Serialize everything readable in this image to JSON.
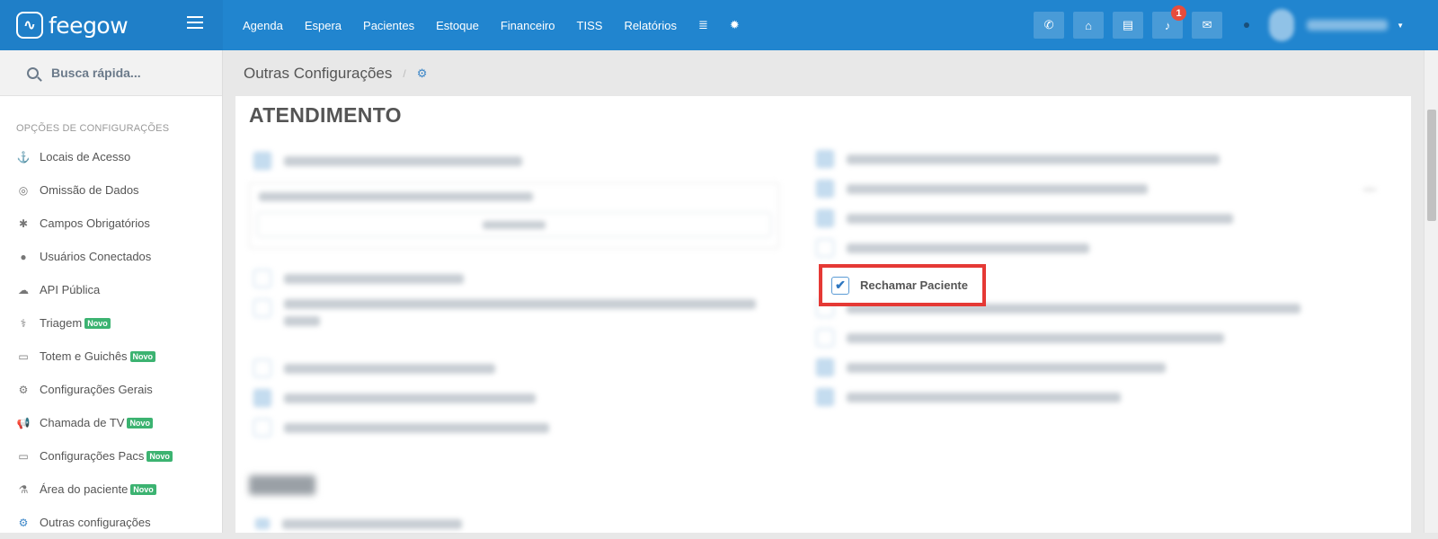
{
  "brand": {
    "logo_icon": "heartbeat-icon",
    "name": "feegow"
  },
  "nav": {
    "items": [
      "Agenda",
      "Espera",
      "Pacientes",
      "Estoque",
      "Financeiro",
      "TISS",
      "Relatórios"
    ],
    "icons": [
      "database-icon",
      "gear-icon"
    ]
  },
  "top_actions": {
    "buttons": [
      "phone-icon",
      "inbox-icon",
      "card-icon",
      "bell-icon",
      "chat-icon"
    ],
    "notification_count": "1"
  },
  "search": {
    "placeholder": "Busca rápida..."
  },
  "sidebar": {
    "header": "OPÇÕES DE CONFIGURAÇÕES",
    "badge_label": "Novo",
    "items": [
      {
        "label": "Locais de Acesso",
        "icon": "⚓"
      },
      {
        "label": "Omissão de Dados",
        "icon": "◎"
      },
      {
        "label": "Campos Obrigatórios",
        "icon": "✱"
      },
      {
        "label": "Usuários Conectados",
        "icon": "●"
      },
      {
        "label": "API Pública",
        "icon": "☁"
      },
      {
        "label": "Triagem",
        "icon": "⚕",
        "novo": true
      },
      {
        "label": "Totem e Guichês",
        "icon": "▭",
        "novo": true
      },
      {
        "label": "Configurações Gerais",
        "icon": "⚙"
      },
      {
        "label": "Chamada de TV",
        "icon": "📢",
        "novo": true
      },
      {
        "label": "Configurações Pacs",
        "icon": "▭",
        "novo": true
      },
      {
        "label": "Área do paciente",
        "icon": "⚗",
        "novo": true
      },
      {
        "label": "Outras configurações",
        "icon": "⚙",
        "active": true
      }
    ]
  },
  "breadcrumb": {
    "title": "Outras Configurações",
    "separator": "/",
    "icon": "gears-icon"
  },
  "section": {
    "title": "ATENDIMENTO",
    "highlighted_option": {
      "label": "Rechamar Paciente",
      "checked": true
    }
  },
  "colors": {
    "primary": "#2185cf",
    "highlight_border": "#e53935",
    "novo_badge": "#3cb371"
  }
}
